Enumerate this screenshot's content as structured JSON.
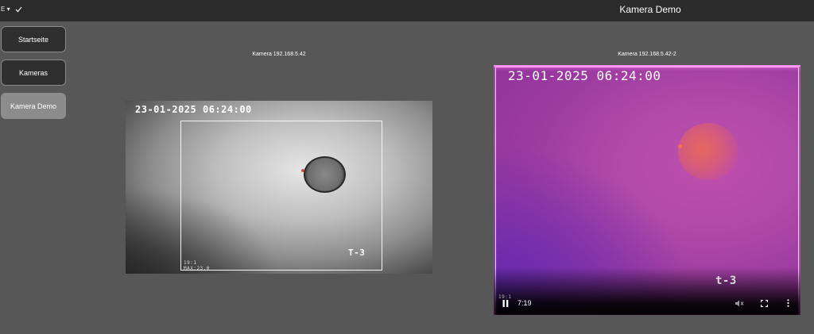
{
  "topbar": {
    "menu_indicator": "E",
    "title": "Kamera Demo",
    "icons": [
      "caret-down-icon",
      "checkmark-icon"
    ]
  },
  "sidebar": {
    "items": [
      {
        "label": "Startseite",
        "active": false
      },
      {
        "label": "Kameras",
        "active": false
      },
      {
        "label": "Kamera Demo",
        "active": true
      }
    ]
  },
  "cameras": [
    {
      "label": "Kamera 192.168.5.42",
      "timestamp": "23-01-2025 06:24:00",
      "tag": "T-3",
      "ratio": "19:1",
      "max": "MAX:23.0"
    },
    {
      "label": "Kamera 192.168.5.42-2",
      "timestamp": "23-01-2025 06:24:00",
      "tag": "t-3",
      "ratio": "19:1",
      "player": {
        "time": "7:19",
        "icons": [
          "pause-icon",
          "mute-icon",
          "fullscreen-icon",
          "more-vert-icon"
        ]
      }
    }
  ],
  "colors": {
    "topbar": "#2b2b2b",
    "background": "#575757",
    "nav_button": "#2f2f2f",
    "nav_button_active": "#8c8c8c",
    "thermal_base": "#9b3aa0",
    "thermal_hot": "#e6665f"
  }
}
